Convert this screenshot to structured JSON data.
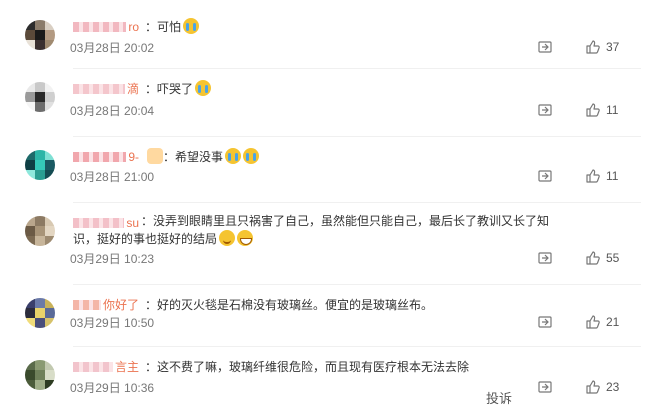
{
  "comments": [
    {
      "name_suffix": "ro",
      "text": "：可怕",
      "emojis": [
        "cry"
      ],
      "time": "03月28日 20:02",
      "likes": "37",
      "avatar_colors": [
        "#2c2c2c",
        "#8a7b6a",
        "#d9cfc3",
        "#5b4a3a",
        "#1a1a1a",
        "#b39a82",
        "#e9e2d8",
        "#3b3030",
        "#a08a70"
      ],
      "name_blur": "#f2b8c0"
    },
    {
      "name_suffix": "滴",
      "text": "：吓哭了",
      "emojis": [
        "cry"
      ],
      "time": "03月28日 20:04",
      "likes": "11",
      "avatar_colors": [
        "#e9e9e9",
        "#c9c9c9",
        "#f2f2f2",
        "#9a9a9a",
        "#2a2a2a",
        "#cfcfcf",
        "#f5f5f5",
        "#6d6d6d",
        "#e0e0e0"
      ],
      "name_blur": "#f4c6cc"
    },
    {
      "name_suffix": "9-",
      "text": "：希望没事",
      "emojis": [
        "badge",
        "cry",
        "cry"
      ],
      "time": "03月28日 21:00",
      "likes": "11",
      "avatar_colors": [
        "#1e6a6a",
        "#2cb5a7",
        "#7fe0d4",
        "#0f3f44",
        "#35c9b9",
        "#1a5a63",
        "#8ee8dc",
        "#2a9d91",
        "#144c52"
      ],
      "name_blur": "#f1a7ad"
    },
    {
      "name_suffix": "su",
      "text": "：没弄到眼睛里且只祸害了自己，虽然能但只能自己，最后长了教训又长了知识，挺好的事也挺好的结局",
      "emojis": [
        "sly",
        "grin"
      ],
      "time": "03月29日 10:23",
      "likes": "55",
      "avatar_colors": [
        "#b9a68c",
        "#8c7a63",
        "#d8c9b2",
        "#6b5a45",
        "#a89478",
        "#e3d6c2",
        "#7c6a52",
        "#c7b59a",
        "#9d8a70"
      ],
      "name_blur": "#f3c0c8"
    },
    {
      "name_suffix": "你好了",
      "text": "：好的灭火毯是石棉没有玻璃丝。便宜的是玻璃丝布。",
      "emojis": [],
      "time": "03月29日 10:50",
      "likes": "21",
      "avatar_colors": [
        "#3a3f6b",
        "#6b7aa8",
        "#c9b25a",
        "#2c2c3c",
        "#e9d36a",
        "#5a6a98",
        "#f0dc7a",
        "#4a4f7b",
        "#d6c26a"
      ],
      "name_blur": "#f4b6a8"
    },
    {
      "name_suffix": "言主",
      "text": "：这不费了嘛，玻璃纤维很危险，而且现有医疗根本无法去除",
      "emojis": [],
      "time": "03月29日 10:36",
      "likes": "23",
      "avatar_colors": [
        "#5a6b4a",
        "#8a9a72",
        "#c2c9b0",
        "#3a4a2c",
        "#6f805a",
        "#d8ddc8",
        "#4c5c3a",
        "#a0ae88",
        "#2e3c22"
      ],
      "name_blur": "#f2c4cc"
    }
  ],
  "footer": {
    "report_label": "投诉"
  },
  "colors": {
    "username": "#eb7350",
    "time": "#777777",
    "text": "#333333"
  },
  "icons": {
    "share": "share-icon",
    "reply": "comment-icon",
    "like": "thumbs-up-icon"
  }
}
